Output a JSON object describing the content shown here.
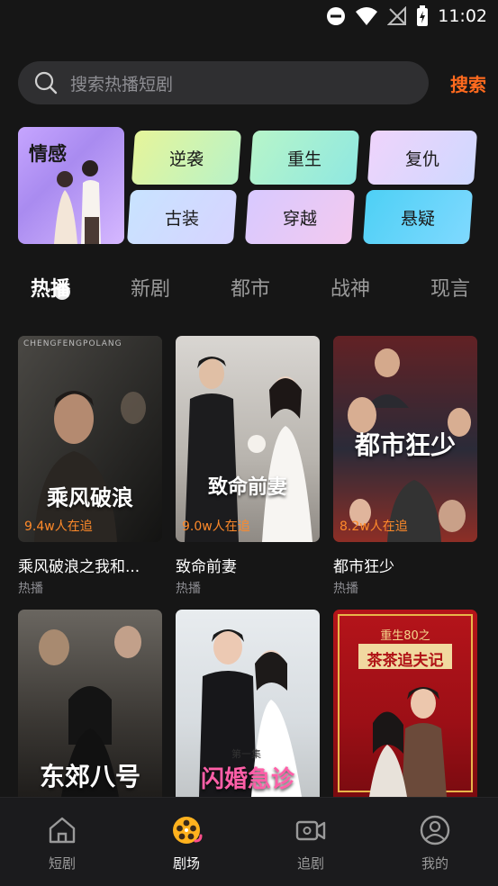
{
  "status": {
    "time": "11:02"
  },
  "search": {
    "placeholder": "搜索热播短剧",
    "button": "搜索"
  },
  "categories": {
    "banner": "情感",
    "items": [
      "逆袭",
      "重生",
      "复仇",
      "古装",
      "穿越",
      "悬疑"
    ]
  },
  "tabs": [
    "热播",
    "新剧",
    "都市",
    "战神",
    "现言"
  ],
  "cards": [
    {
      "poster_text": "乘风破浪",
      "poster_sub": "CHENGFENGPOLANG",
      "views": "9.4w人在追",
      "title": "乘风破浪之我和...",
      "tag": "热播"
    },
    {
      "poster_text": "致命前妻",
      "views": "9.0w人在追",
      "title": "致命前妻",
      "tag": "热播"
    },
    {
      "poster_text": "都市狂少",
      "views": "8.2w人在追",
      "title": "都市狂少",
      "tag": "热播"
    },
    {
      "poster_text": "东郊八号",
      "title": "",
      "tag": ""
    },
    {
      "poster_text": "闪婚急诊",
      "poster_sub": "第一集",
      "title": "",
      "tag": ""
    },
    {
      "poster_text": "茶茶追夫记",
      "poster_sub": "重生80之",
      "title": "",
      "tag": ""
    }
  ],
  "bottom_nav": [
    {
      "label": "短剧",
      "icon": "home-icon"
    },
    {
      "label": "剧场",
      "icon": "theater-icon"
    },
    {
      "label": "追剧",
      "icon": "video-camera-icon"
    },
    {
      "label": "我的",
      "icon": "profile-icon"
    }
  ],
  "colors": {
    "accent": "#ff6a1e",
    "background": "#161616"
  }
}
